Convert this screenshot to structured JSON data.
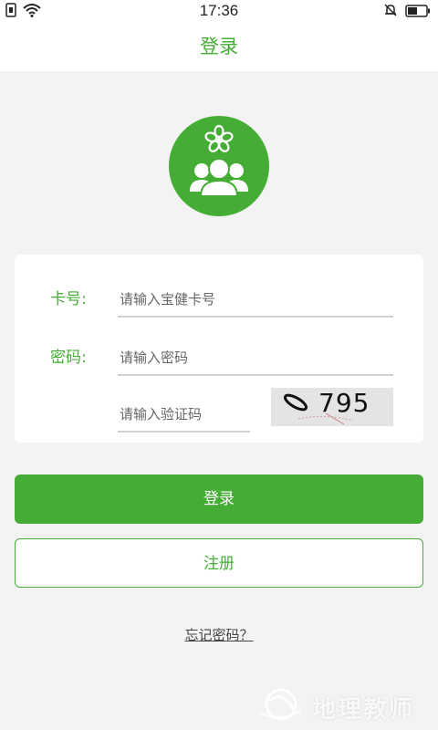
{
  "status_bar": {
    "time": "17:36",
    "left_icons": [
      "sim-icon",
      "wifi-icon"
    ],
    "right_icons": [
      "mute-bell-icon",
      "battery-icon"
    ]
  },
  "header": {
    "title": "登录"
  },
  "logo": {
    "icon": "user-group-with-flower-icon"
  },
  "form": {
    "card_label": "卡号:",
    "card_placeholder": "请输入宝健卡号",
    "password_label": "密码:",
    "password_placeholder": "请输入密码",
    "captcha_placeholder": "请输入验证码",
    "captcha_text": "795"
  },
  "buttons": {
    "login_label": "登录",
    "register_label": "注册"
  },
  "links": {
    "forgot_password": "忘记密码？"
  },
  "watermark": {
    "text": "地理教师"
  },
  "colors": {
    "accent": "#45ad35",
    "background": "#f3f3f3",
    "card": "#ffffff"
  }
}
